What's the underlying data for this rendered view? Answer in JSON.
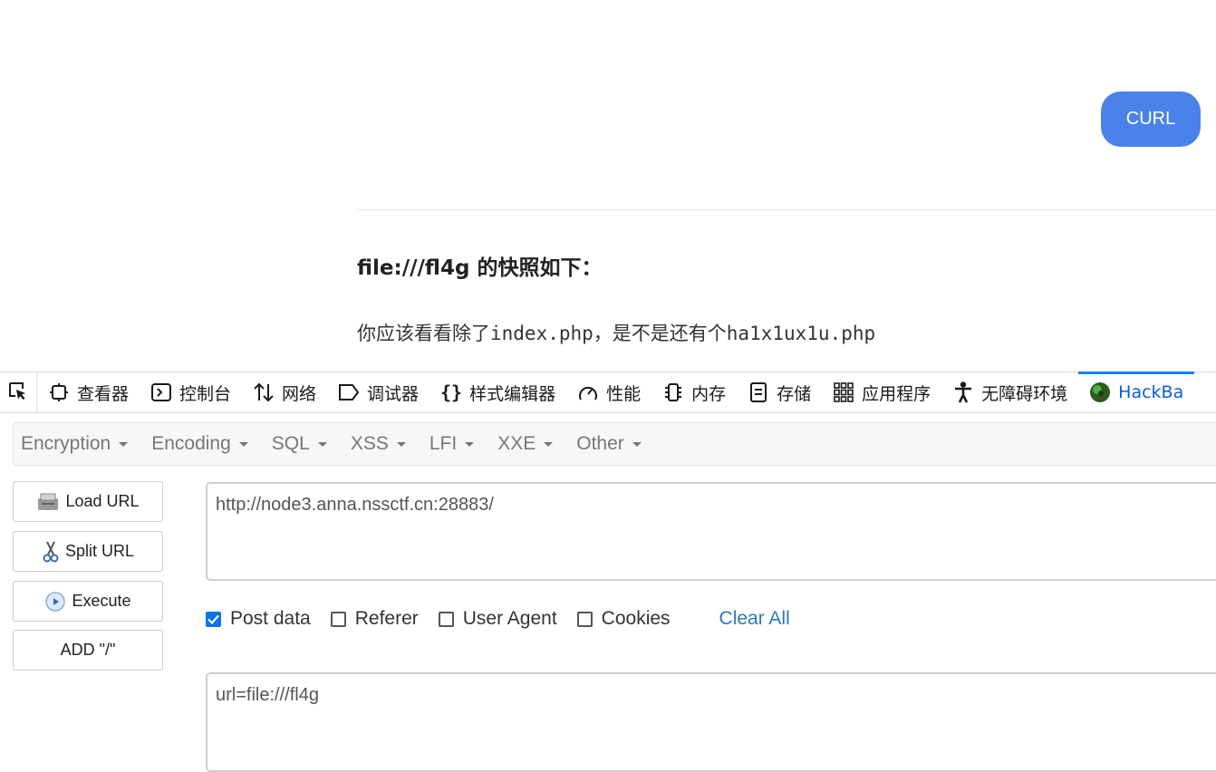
{
  "page": {
    "curl_button": "CURL",
    "snapshot_title": "file:///fl4g 的快照如下：",
    "hint": "你应该看看除了index.php，是不是还有个ha1x1ux1u.php"
  },
  "devtools": {
    "tabs": [
      {
        "label": "查看器",
        "icon": "inspector-icon"
      },
      {
        "label": "控制台",
        "icon": "console-icon"
      },
      {
        "label": "网络",
        "icon": "network-icon"
      },
      {
        "label": "调试器",
        "icon": "debugger-icon"
      },
      {
        "label": "样式编辑器",
        "icon": "style-editor-icon"
      },
      {
        "label": "性能",
        "icon": "performance-icon"
      },
      {
        "label": "内存",
        "icon": "memory-icon"
      },
      {
        "label": "存储",
        "icon": "storage-icon"
      },
      {
        "label": "应用程序",
        "icon": "application-icon"
      },
      {
        "label": "无障碍环境",
        "icon": "accessibility-icon"
      },
      {
        "label": "HackBa",
        "icon": "hackbar-icon",
        "active": true
      }
    ]
  },
  "hackbar": {
    "menu": [
      "Encryption",
      "Encoding",
      "SQL",
      "XSS",
      "LFI",
      "XXE",
      "Other"
    ],
    "buttons": {
      "load_url": "Load URL",
      "split_url": "Split URL",
      "execute": "Execute",
      "add_slash": "ADD \"/\""
    },
    "url_value": "http://node3.anna.nssctf.cn:28883/",
    "options": {
      "post_data": {
        "label": "Post data",
        "checked": true
      },
      "referer": {
        "label": "Referer",
        "checked": false
      },
      "user_agent": {
        "label": "User Agent",
        "checked": false
      },
      "cookies": {
        "label": "Cookies",
        "checked": false
      }
    },
    "clear_all": "Clear All",
    "post_value": "url=file:///fl4g"
  },
  "colors": {
    "curl_button": "#4a82ea",
    "active_tab": "#0a84ff",
    "checkbox_checked": "#0a75e8",
    "clear_all_link": "#2a7ab8"
  }
}
